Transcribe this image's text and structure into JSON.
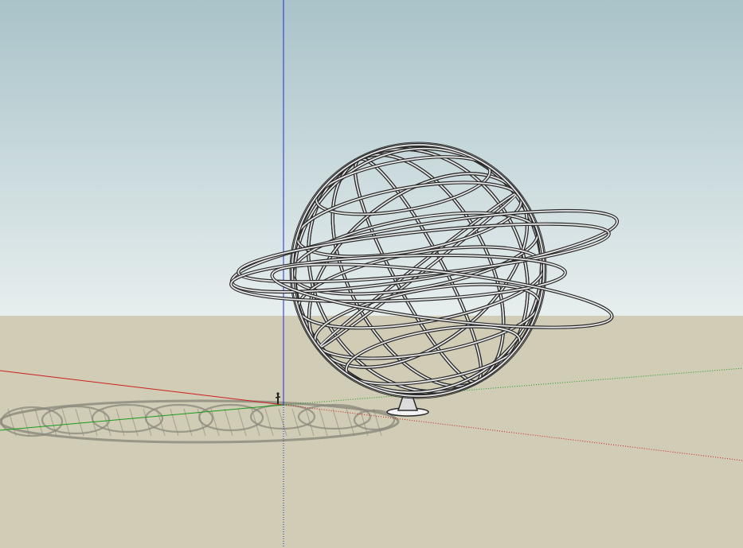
{
  "viewport": {
    "name": "sketchup-3d-viewport",
    "colors": {
      "sky_top": "#a9c3c9",
      "sky_bottom": "#e7eeee",
      "ground": "#d0ccb5",
      "axis_red": "#cc1f1f",
      "axis_green": "#1c9a1c",
      "axis_blue": "#1f2fd6",
      "wire_outline": "#2a2a2a",
      "wire_fill": "#e8e8e8",
      "shadow": "#8a887c"
    },
    "icons": [
      "axes-origin-icon",
      "person-scale-figure-icon"
    ]
  },
  "model": {
    "object": "wireframe-globe-with-orbit-rings",
    "meridian_count": 8,
    "parallel_count": 6,
    "orbit_ring_count": 3
  }
}
